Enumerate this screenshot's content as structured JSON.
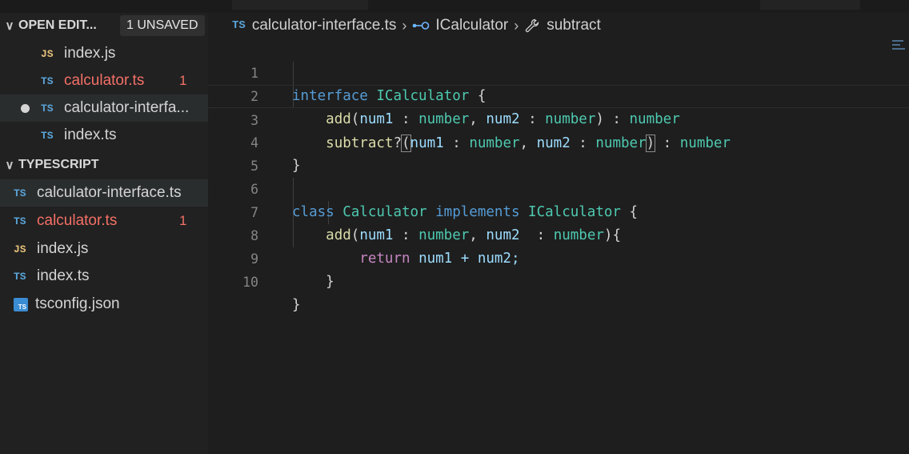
{
  "sidebar": {
    "open_editors": {
      "title": "OPEN EDIT...",
      "badge": "1 UNSAVED",
      "items": [
        {
          "type": "JS",
          "name": "index.js",
          "errors": ""
        },
        {
          "type": "TS",
          "name": "calculator.ts",
          "errors": "1"
        },
        {
          "type": "TS",
          "name": "calculator-interfa...",
          "errors": ""
        },
        {
          "type": "TS",
          "name": "index.ts",
          "errors": ""
        }
      ]
    },
    "project": {
      "title": "TYPESCRIPT",
      "items": [
        {
          "type": "TS",
          "name": "calculator-interface.ts",
          "errors": ""
        },
        {
          "type": "TS",
          "name": "calculator.ts",
          "errors": "1"
        },
        {
          "type": "JS",
          "name": "index.js",
          "errors": ""
        },
        {
          "type": "TS",
          "name": "index.ts",
          "errors": ""
        },
        {
          "type": "TS",
          "name": "tsconfig.json",
          "errors": ""
        }
      ]
    }
  },
  "breadcrumb": {
    "file_type": "TS",
    "file": "calculator-interface.ts",
    "interface": "ICalculator",
    "member": "subtract"
  },
  "line_numbers": [
    "1",
    "2",
    "3",
    "4",
    "5",
    "6",
    "7",
    "8",
    "9",
    "10"
  ],
  "code": {
    "l1": {
      "kw": "interface",
      "name": "ICalculator",
      "brace": "{"
    },
    "l2": {
      "fn": "add",
      "p1": "num1",
      "t1": "number",
      "p2": "num2",
      "t2": "number",
      "ret": "number"
    },
    "l3": {
      "fn": "subtract",
      "opt": "?",
      "p1": "num1",
      "t1": "number",
      "p2": "num2",
      "t2": "number",
      "ret": "number"
    },
    "l4": {
      "brace": "}"
    },
    "l6": {
      "kw": "class",
      "name": "Calculator",
      "kw2": "implements",
      "iface": "ICalculator",
      "brace": "{"
    },
    "l7": {
      "fn": "add",
      "p1": "num1",
      "t1": "number",
      "p2": "num2",
      "t2": "number",
      "brace": "{"
    },
    "l8": {
      "kw": "return",
      "expr": "num1 + num2;"
    },
    "l9": {
      "brace": "}"
    },
    "l10": {
      "brace": "}"
    }
  }
}
